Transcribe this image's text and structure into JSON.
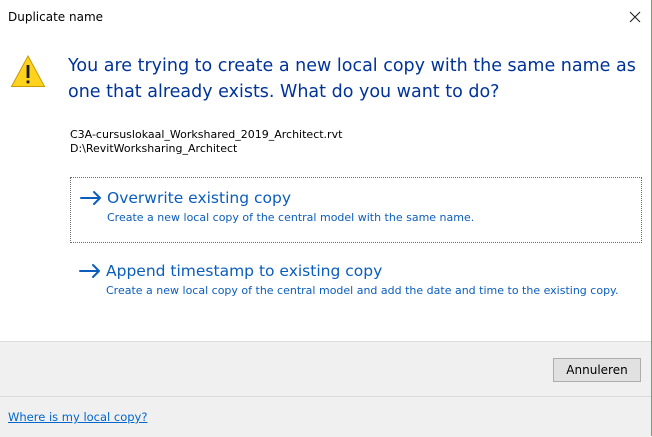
{
  "window": {
    "title": "Duplicate name",
    "close_icon": "close-icon"
  },
  "content": {
    "warning_icon": "warning-icon",
    "main_instruction": "You are trying to create a new local copy with the same name as one that already exists. What do you want to do?",
    "file_name": "C3A-cursuslokaal_Workshared_2019_Architect.rvt",
    "file_path": "D:\\RevitWorksharing_Architect"
  },
  "commands": [
    {
      "label": "Overwrite existing copy",
      "description": "Create a new local copy of the central model with the same name.",
      "icon": "arrow-right-icon"
    },
    {
      "label": "Append timestamp to existing copy",
      "description": "Create a new local copy of the central model and add the date and time to the existing copy.",
      "icon": "arrow-right-icon"
    }
  ],
  "buttons": {
    "cancel_label": "Annuleren"
  },
  "footer": {
    "link_text": "Where is my local copy?"
  },
  "colors": {
    "instruction": "#003399",
    "command_link": "#0b5dbd",
    "footer_link": "#0066cc",
    "warning_fill": "#ffd21e"
  }
}
